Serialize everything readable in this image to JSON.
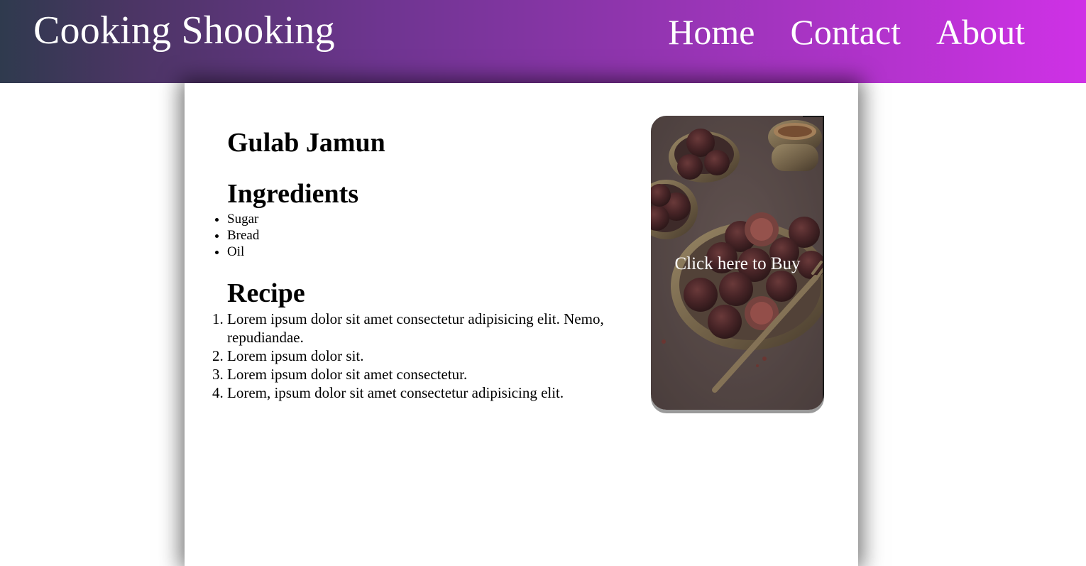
{
  "navbar": {
    "brand": "Cooking Shooking",
    "links": [
      "Home",
      "Contact",
      "About"
    ]
  },
  "recipe": {
    "title": "Gulab Jamun",
    "ingredients_heading": "Ingredients",
    "ingredients": [
      "Sugar",
      "Bread",
      "Oil"
    ],
    "recipe_heading": "Recipe",
    "steps": [
      "Lorem ipsum dolor sit amet consectetur adipisicing elit. Nemo, repudiandae.",
      "Lorem ipsum dolor sit.",
      "Lorem ipsum dolor sit amet consectetur.",
      "Lorem, ipsum dolor sit amet consectetur adipisicing elit."
    ]
  },
  "buy_card": {
    "label": "Click here to Buy",
    "image_icon": "gulab-jamun-photo"
  },
  "colors": {
    "gradient_start": "#2f3a4e",
    "gradient_end": "#cf31e6",
    "text_on_header": "#ffffff"
  }
}
